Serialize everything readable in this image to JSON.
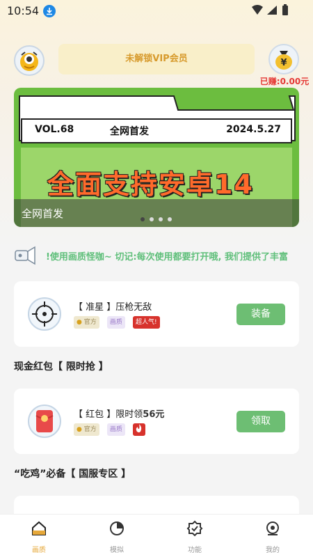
{
  "status_bar": {
    "time": "10:54"
  },
  "header": {
    "vip_text": "未解锁VIP会员",
    "earned_text": "已赚:0.00元"
  },
  "carousel": {
    "volume": "VOL.68",
    "release": "全网首发",
    "date": "2024.5.27",
    "headline": "全面支持安卓14",
    "caption": "全网首发"
  },
  "notice": {
    "text": "!使用画质怪咖~ 切记:每次使用都要打开哦, 我们提供了丰富"
  },
  "items": [
    {
      "bracket_label": "【 准星 】",
      "title": "压枪无敌",
      "tags": [
        "官方",
        "画质",
        "超人气!"
      ],
      "button": "装备"
    },
    {
      "bracket_label": "【 红包 】",
      "title": "限时领",
      "amount": "56元",
      "tags": [
        "官方",
        "画质"
      ],
      "button": "领取"
    }
  ],
  "sections": {
    "cash_redpacket": "现金红包【 限时抢 】",
    "chicken_required": "“吃鸡”必备【 国服专区 】"
  },
  "tabbar": {
    "tabs": [
      "画质",
      "模拟",
      "功能",
      "我的"
    ]
  },
  "colors": {
    "accent_green": "#6dbe73",
    "banner_green": "#6cbd3f",
    "earned_red": "#e53935",
    "tab_active": "#e6a83a"
  }
}
